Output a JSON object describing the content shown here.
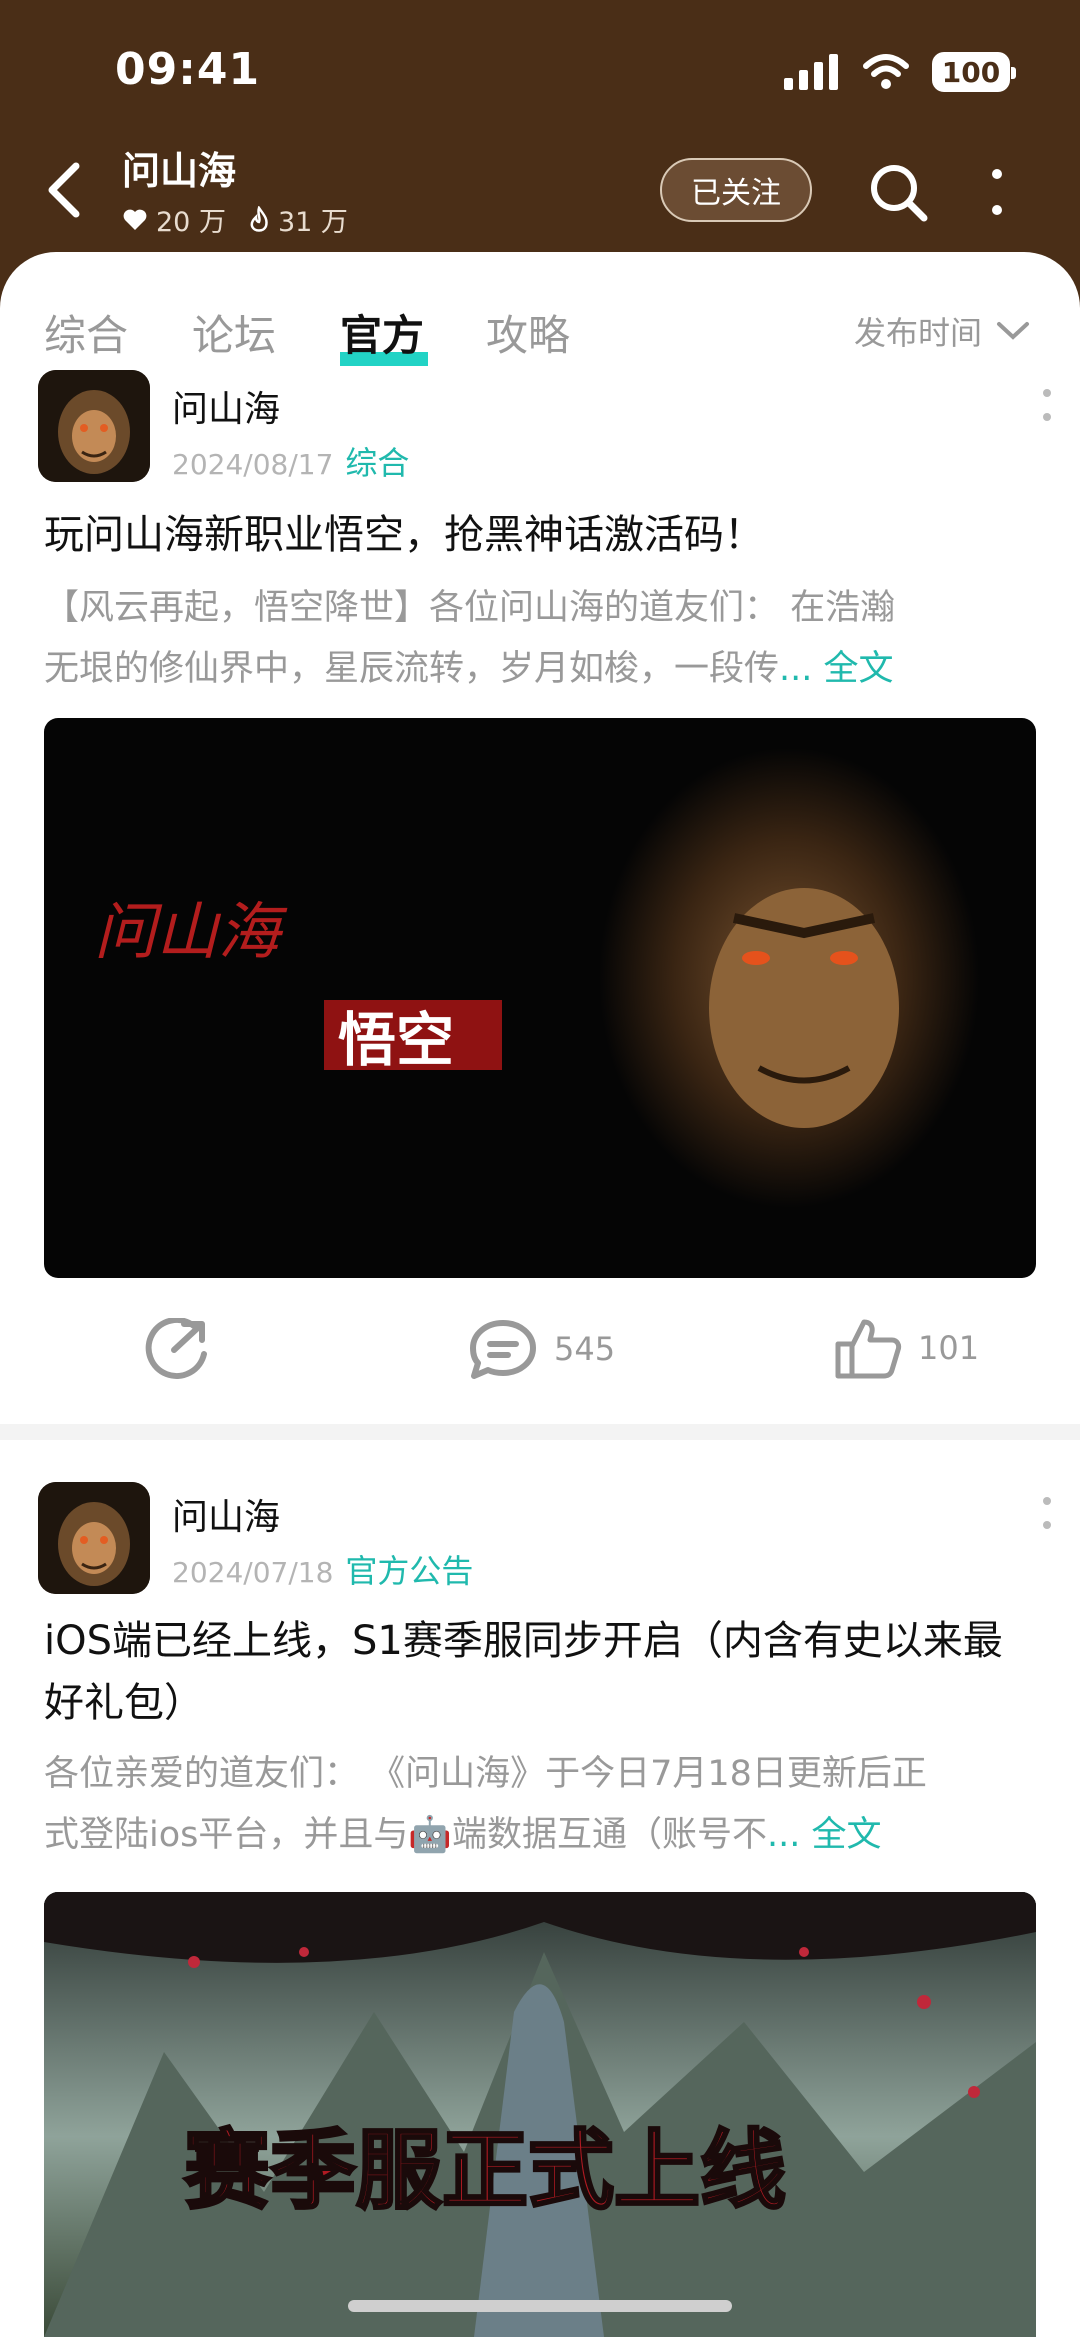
{
  "status": {
    "time": "09:41",
    "battery": "100"
  },
  "header": {
    "title": "问山海",
    "likes": "20 万",
    "heat": "31 万",
    "follow_label": "已关注"
  },
  "tabs": [
    {
      "label": "综合"
    },
    {
      "label": "论坛"
    },
    {
      "label": "官方"
    },
    {
      "label": "攻略"
    }
  ],
  "sort_label": "发布时间",
  "posts": [
    {
      "author": "问山海",
      "date": "2024/08/17",
      "category": "综合",
      "title": "玩问山海新职业悟空，抢黑神话激活码！",
      "excerpt_line1": "【风云再起，悟空降世】各位问山海的道友们：   在浩瀚",
      "excerpt_line2": "无垠的修仙界中，星辰流转，岁月如梭，一段传",
      "more_label": "... 全文",
      "image_text_left": "问山海",
      "image_text_box": "悟空",
      "comments": "545",
      "likes": "101"
    },
    {
      "author": "问山海",
      "date": "2024/07/18",
      "category": "官方公告",
      "title": "iOS端已经上线，S1赛季服同步开启（内含有史以来最好礼包）",
      "excerpt_line1": "各位亲爱的道友们：  《问山海》于今日7月18日更新后正",
      "excerpt_line2": "式登陆ios平台，并且与🤖端数据互通（账号不",
      "more_label": "... 全文",
      "image_text": "赛季服正式上线"
    }
  ],
  "colors": {
    "header_bg": "#4a2e17",
    "accent": "#22d3c5"
  }
}
